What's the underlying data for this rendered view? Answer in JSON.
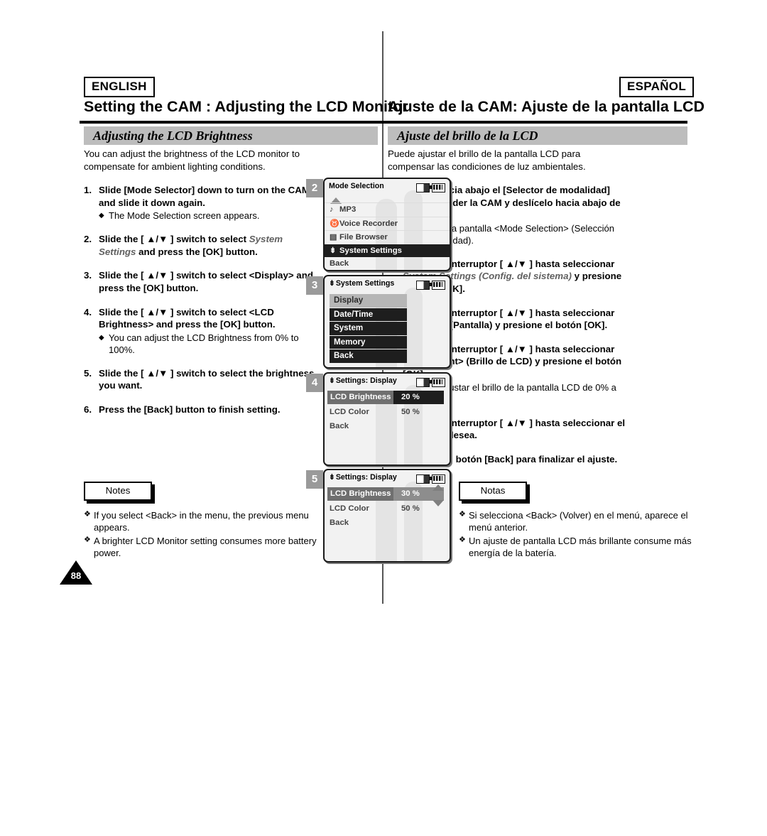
{
  "header": {
    "lang_left": "ENGLISH",
    "lang_right": "ESPAÑOL",
    "title_left": "Setting the CAM : Adjusting the LCD Monitor",
    "title_right": "Ajuste de la CAM: Ajuste de la pantalla LCD",
    "section_left": "Adjusting the LCD Brightness",
    "section_right": "Ajuste del brillo de la LCD"
  },
  "english": {
    "intro": "You can adjust the brightness of the LCD monitor to compensate for ambient lighting conditions.",
    "steps": [
      {
        "num": "1.",
        "text": "Slide [Mode Selector] down to turn on the CAM and slide it down again.",
        "bullet": "The Mode Selection screen appears."
      },
      {
        "num": "2.",
        "text_pre": "Slide the [ ▲/▼ ] switch to select ",
        "text_italic": "System Settings",
        "text_post": " and press the [OK] button.",
        "bullet": ""
      },
      {
        "num": "3.",
        "text": "Slide the [ ▲/▼ ] switch to select <Display> and press the [OK] button.",
        "bullet": ""
      },
      {
        "num": "4.",
        "text": "Slide the [ ▲/▼ ] switch to select <LCD Brightness> and press the [OK] button.",
        "bullet": "You can adjust the LCD Brightness from 0% to 100%."
      },
      {
        "num": "5.",
        "text": "Slide the [ ▲/▼ ] switch to select the brightness you want.",
        "bullet": ""
      },
      {
        "num": "6.",
        "text": "Press the [Back] button to finish setting.",
        "bullet": ""
      }
    ],
    "notes_label": "Notes",
    "notes": [
      "If you select <Back> in the menu, the previous menu appears.",
      "A brighter LCD Monitor setting consumes more battery power."
    ]
  },
  "spanish": {
    "intro": "Puede ajustar el brillo de la pantalla LCD para compensar las condiciones de luz ambientales.",
    "steps": [
      {
        "num": "1.",
        "text": "Deslice hacia abajo el [Selector de modalidad] para encender la CAM y deslícelo hacia abajo de nuevo.",
        "bullet": "Aparece la pantalla <Mode Selection> (Selección de modalidad)."
      },
      {
        "num": "2.",
        "text_pre": "Deslice el interruptor [ ▲/▼ ] hasta seleccionar ",
        "text_italic": "System Settings (Config. del sistema)",
        "text_post": " y presione el botón [OK].",
        "bullet": ""
      },
      {
        "num": "3.",
        "text": "Deslice el interruptor [ ▲/▼ ] hasta seleccionar <Display> (Pantalla)  y presione el botón [OK].",
        "bullet": ""
      },
      {
        "num": "4.",
        "text": "Deslice el interruptor [ ▲/▼ ] hasta seleccionar <LCD Bright> (Brillo de LCD) y presione el botón [OK].",
        "bullet": "Puede ajustar el brillo de la pantalla LCD de 0% a 100%."
      },
      {
        "num": "5.",
        "text": "Deslice el interruptor [ ▲/▼ ] hasta seleccionar el brillo que desea.",
        "bullet": ""
      },
      {
        "num": "6.",
        "text": "Presione el botón [Back] para finalizar el ajuste.",
        "bullet": ""
      }
    ],
    "notes_label": "Notas",
    "notes": [
      "Si selecciona <Back> (Volver) en el menú, aparece el menú anterior.",
      "Un ajuste de pantalla LCD más brillante consume más energía de la batería."
    ]
  },
  "lcd_screens": [
    {
      "badge": "2",
      "title": "Mode Selection",
      "tool_icon": "",
      "rows": [
        {
          "glyph": "♪",
          "label": "MP3",
          "highlight": false
        },
        {
          "glyph": "♉",
          "label": "Voice Recorder",
          "highlight": false
        },
        {
          "glyph": "▤",
          "label": "File Browser",
          "highlight": false
        },
        {
          "glyph": "⇟",
          "label": "System Settings",
          "highlight": true
        },
        {
          "glyph": "",
          "label": "Back",
          "highlight": false
        }
      ]
    },
    {
      "badge": "3",
      "title": "System Settings",
      "tool_icon": "⇟",
      "blocks": [
        {
          "label": "Display",
          "selected": true
        },
        {
          "label": "Date/Time",
          "selected": false
        },
        {
          "label": "System",
          "selected": false
        },
        {
          "label": "Memory",
          "selected": false
        },
        {
          "label": "Back",
          "selected": false
        }
      ]
    },
    {
      "badge": "4",
      "title": "Settings: Display",
      "tool_icon": "⇟",
      "values": [
        {
          "label": "LCD Brightness",
          "value": "20 %",
          "selected": true,
          "dark": true
        },
        {
          "label": "LCD Color",
          "value": "50 %",
          "selected": false,
          "dark": false
        }
      ],
      "back_label": "Back",
      "scroll_arrows": false
    },
    {
      "badge": "5",
      "title": "Settings: Display",
      "tool_icon": "⇟",
      "values": [
        {
          "label": "LCD Brightness",
          "value": "30 %",
          "selected": true,
          "dark": false
        },
        {
          "label": "LCD Color",
          "value": "50 %",
          "selected": false,
          "dark": false
        }
      ],
      "back_label": "Back",
      "scroll_arrows": true
    }
  ],
  "page_number": "88"
}
